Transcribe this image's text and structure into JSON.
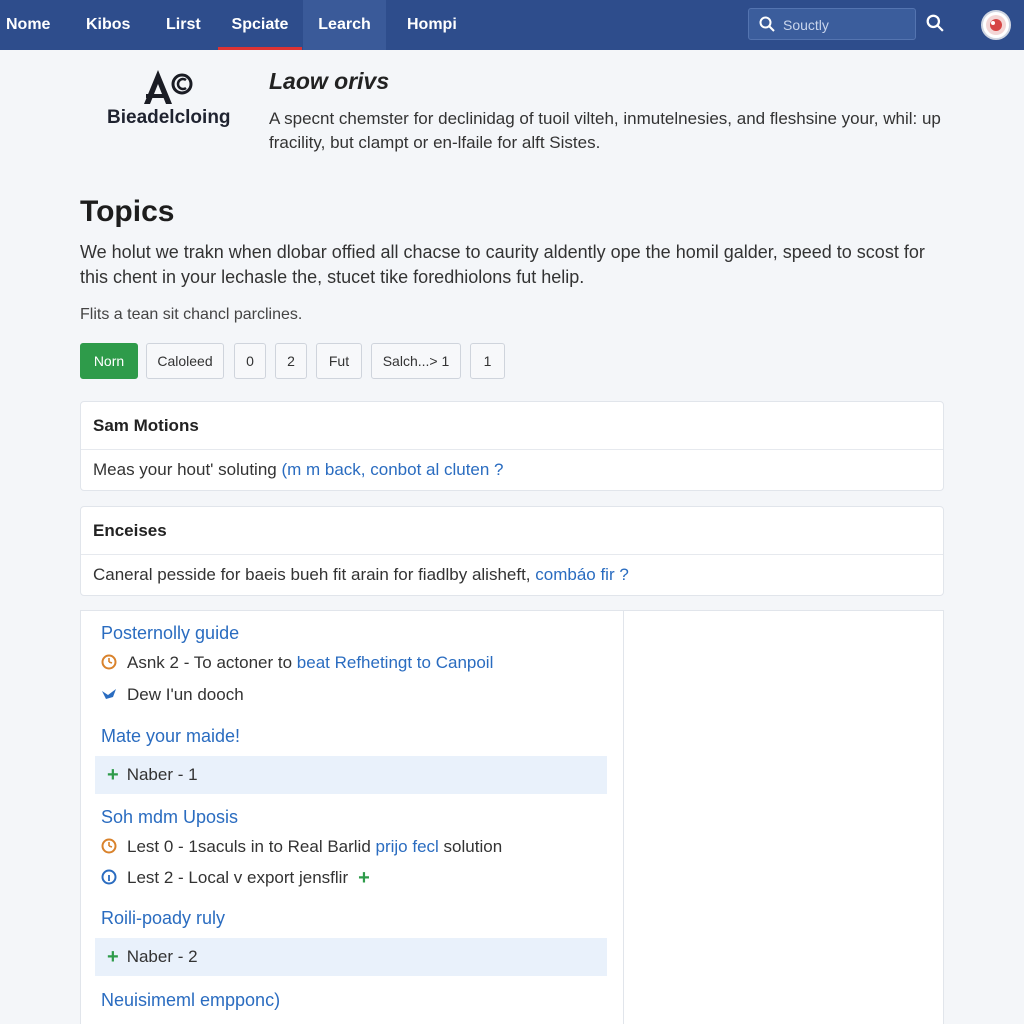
{
  "nav": {
    "items": [
      "Nome",
      "Kibos",
      "Lirst",
      "Spciate",
      "Learch",
      "Hompi"
    ],
    "search_placeholder": "Souctly"
  },
  "header": {
    "logo_text": "Bieadelcloing",
    "title": "Laow orivs",
    "description": "A specnt chemster for declinidag of tuoil vilteh, inmutelnesies, and fleshsine your, whil: up fracility, but clampt or en-lfaile for alft Sistes."
  },
  "topics": {
    "title": "Topics",
    "description": "We holut we trakn when dlobar offied all chacse to caurity aldently ope the homil galder, speed to scost for this chent in your lechasle the, stucet tike foredhiolons fut helip.",
    "filter_label": "Flits a tean sit chancl parclines.",
    "buttons": [
      "Norn",
      "Caloleed",
      "0",
      "2",
      "Fut",
      "Salch...>  1",
      "1"
    ]
  },
  "cards": [
    {
      "title": "Sam Motions",
      "text": "Meas your hout' soluting ",
      "link": "(m m back, conbot al cluten ?"
    },
    {
      "title": "Enceises",
      "text": "Caneral pesside for baeis bueh fit arain for fiadlby alisheft, ",
      "link": "combáo fir ?"
    }
  ],
  "panel": {
    "sections": [
      {
        "title": "Posternolly guide"
      },
      {
        "title": "Mate your maide!"
      },
      {
        "title": "Soh mdm Uposis"
      },
      {
        "title": "Roili-poady ruly"
      },
      {
        "title": "Neuisimeml empponc)"
      }
    ],
    "rows": [
      {
        "text": "Asnk  2 - To actoner to ",
        "link": "beat Refhetingt to Canpoil"
      },
      {
        "text": "Dew I'un dooch"
      },
      {
        "text": "Naber - 1"
      },
      {
        "text": "Lest  0  -  1saculs in to Real Barlid ",
        "link": "prijo fecl",
        "tail": " solution"
      },
      {
        "text": "Lest  2  -  Local  v  export  jensflir"
      },
      {
        "text": "Naber - 2"
      }
    ]
  },
  "colors": {
    "nav": "#2e4d8c",
    "accent_green": "#2e9b4a",
    "link_blue": "#2a6cc0"
  }
}
